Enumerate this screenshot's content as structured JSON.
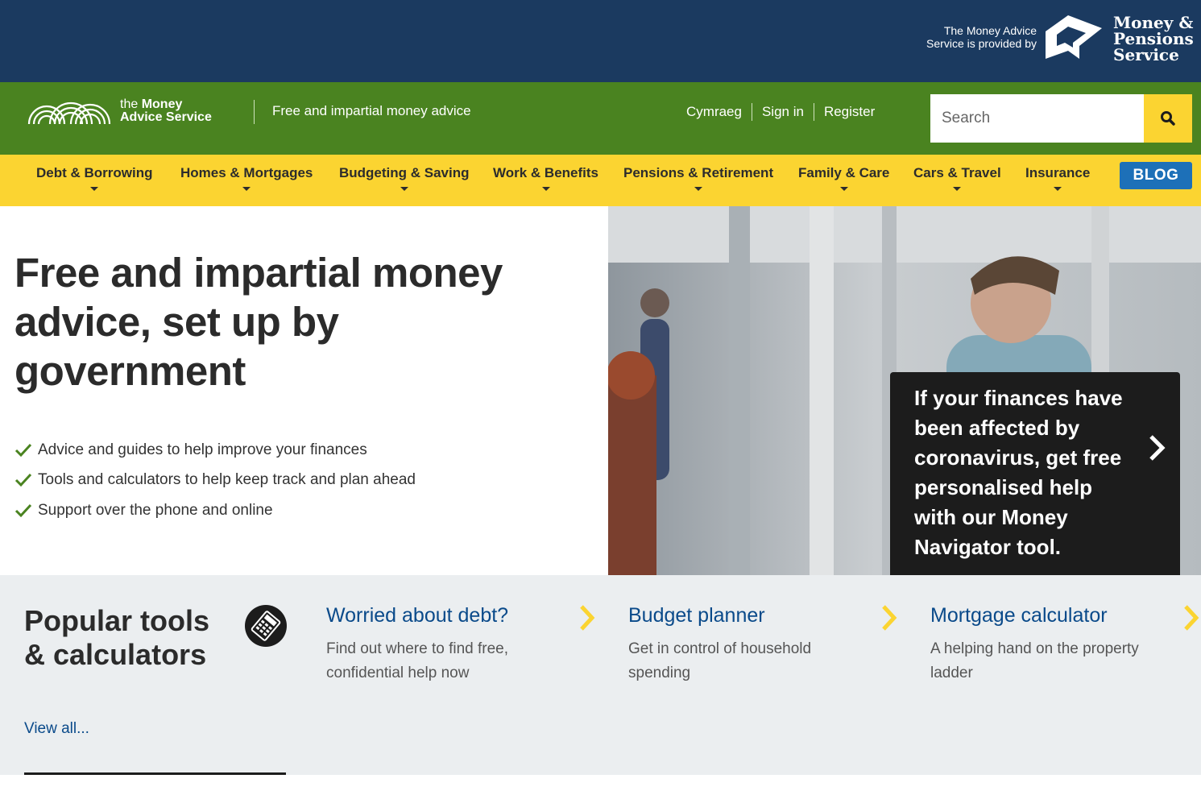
{
  "maps_bar": {
    "provided_by_line1": "The Money Advice",
    "provided_by_line2": "Service is provided by",
    "logo_line1": "Money &",
    "logo_line2": "Pensions",
    "logo_line3": "Service"
  },
  "header": {
    "logo_the": "the",
    "logo_money": "Money",
    "logo_advice_service": "Advice Service",
    "tagline": "Free and impartial money advice",
    "links": [
      "Cymraeg",
      "Sign in",
      "Register"
    ],
    "search_placeholder": "Search"
  },
  "nav": {
    "items": [
      "Debt & Borrowing",
      "Homes & Mortgages",
      "Budgeting & Saving",
      "Work & Benefits",
      "Pensions & Retirement",
      "Family & Care",
      "Cars & Travel",
      "Insurance"
    ],
    "blog_label": "BLOG"
  },
  "hero": {
    "title": "Free and impartial money advice, set up by government",
    "bullets": [
      "Advice and guides to help improve your finances",
      "Tools and calculators to help keep track and plan ahead",
      "Support over the phone and online"
    ],
    "promo_text": "If your finances have been affected by coronavirus, get free personalised help with our Money Navigator tool."
  },
  "tools": {
    "heading": "Popular tools & calculators",
    "view_all": "View all...",
    "cards": [
      {
        "title": "Worried about debt?",
        "desc": "Find out where to find free, confidential help now"
      },
      {
        "title": "Budget planner",
        "desc": "Get in control of household spending"
      },
      {
        "title": "Mortgage calculator",
        "desc": "A helping hand on the property ladder"
      }
    ]
  },
  "colors": {
    "maps_navy": "#1b3a60",
    "header_green": "#4a8320",
    "nav_yellow": "#fbd431",
    "blog_blue": "#1d70b8",
    "link_blue": "#0a4a8a",
    "tools_bg": "#ebeef0",
    "tick_green": "#4a8320"
  },
  "icons": [
    "maps-logo-icon",
    "rainbow-arcs-icon",
    "search-icon",
    "caret-down-icon",
    "tick-icon",
    "chevron-right-icon",
    "calculator-icon"
  ]
}
